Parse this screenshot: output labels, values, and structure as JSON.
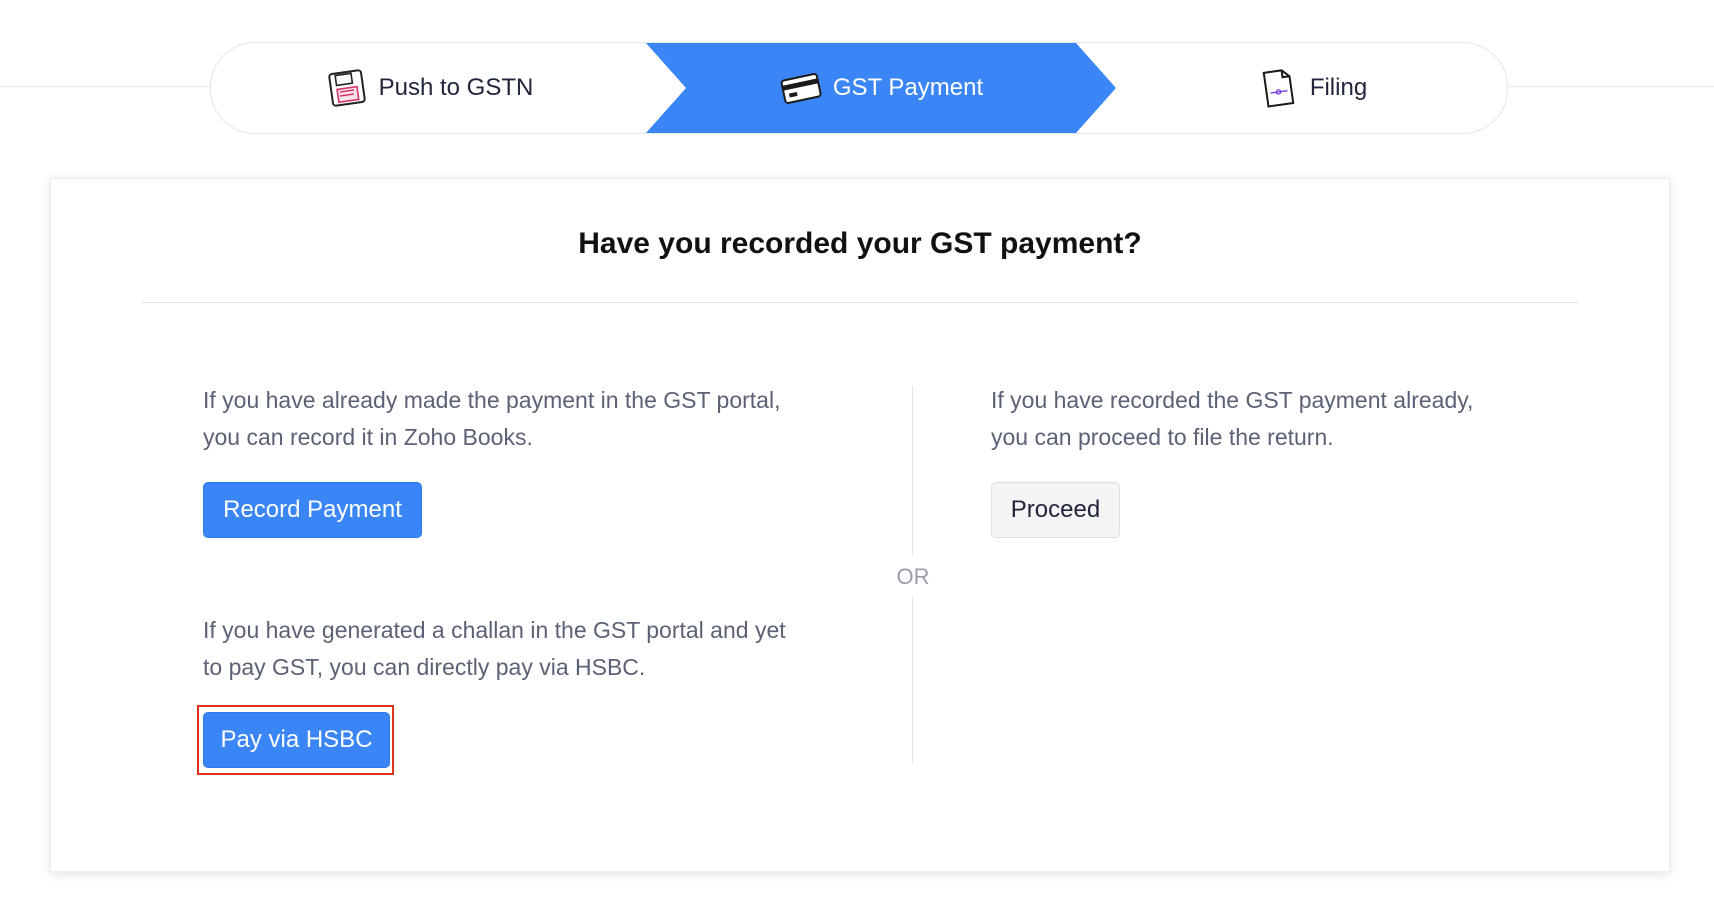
{
  "stepper": {
    "steps": [
      {
        "label": "Push to GSTN",
        "icon": "floppy-disk-icon",
        "active": false
      },
      {
        "label": "GST Payment",
        "icon": "credit-card-icon",
        "active": true
      },
      {
        "label": "Filing",
        "icon": "document-icon",
        "active": false
      }
    ],
    "active_color": "#3b86f7"
  },
  "card": {
    "title": "Have you recorded your GST payment?",
    "or_label": "OR",
    "record": {
      "line1": "If you have already made the payment in the GST portal,",
      "line2": "you can record it in Zoho Books.",
      "button_label": "Record Payment"
    },
    "hsbc": {
      "line1": "If you have generated a challan in the GST portal and yet",
      "line2": "to pay GST, you can directly pay via HSBC.",
      "button_label": "Pay via HSBC"
    },
    "proceed": {
      "line1": "If you have recorded the GST payment already,",
      "line2": "you can proceed to file the return.",
      "button_label": "Proceed"
    }
  },
  "colors": {
    "primary": "#3b86f7",
    "highlight": "#e0331f"
  }
}
